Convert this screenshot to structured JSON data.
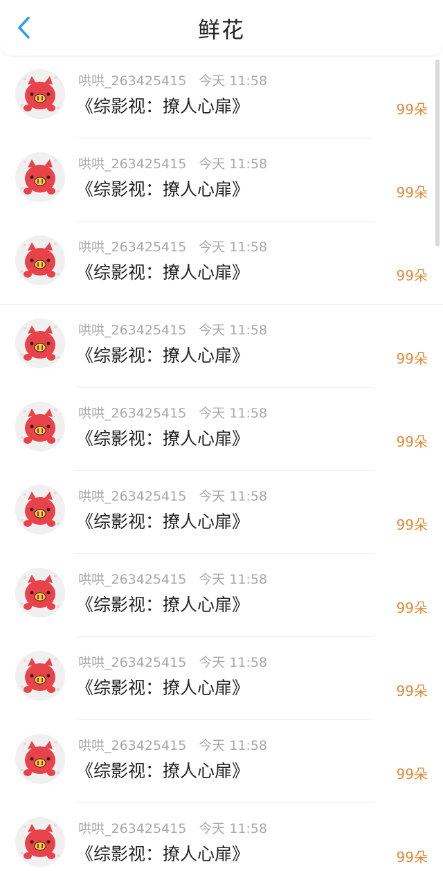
{
  "header": {
    "title": "鲜花"
  },
  "colors": {
    "accent": "#2a9de8",
    "count": "#e08a3c",
    "meta": "#a8a8a8",
    "avatar": "#e8434a"
  },
  "icons": {
    "back": "chevron-left-icon",
    "avatar": "red-pig-avatar-icon"
  },
  "items": [
    {
      "user": "哄哄_263425415",
      "time": "今天 11:58",
      "title": "《综影视：撩人心扉》",
      "count": "99朵"
    },
    {
      "user": "哄哄_263425415",
      "time": "今天 11:58",
      "title": "《综影视：撩人心扉》",
      "count": "99朵"
    },
    {
      "user": "哄哄_263425415",
      "time": "今天 11:58",
      "title": "《综影视：撩人心扉》",
      "count": "99朵"
    },
    {
      "user": "哄哄_263425415",
      "time": "今天 11:58",
      "title": "《综影视：撩人心扉》",
      "count": "99朵"
    },
    {
      "user": "哄哄_263425415",
      "time": "今天 11:58",
      "title": "《综影视：撩人心扉》",
      "count": "99朵"
    },
    {
      "user": "哄哄_263425415",
      "time": "今天 11:58",
      "title": "《综影视：撩人心扉》",
      "count": "99朵"
    },
    {
      "user": "哄哄_263425415",
      "time": "今天 11:58",
      "title": "《综影视：撩人心扉》",
      "count": "99朵"
    },
    {
      "user": "哄哄_263425415",
      "time": "今天 11:58",
      "title": "《综影视：撩人心扉》",
      "count": "99朵"
    },
    {
      "user": "哄哄_263425415",
      "time": "今天 11:58",
      "title": "《综影视：撩人心扉》",
      "count": "99朵"
    },
    {
      "user": "哄哄_263425415",
      "time": "今天 11:58",
      "title": "《综影视：撩人心扉》",
      "count": "99朵"
    }
  ]
}
